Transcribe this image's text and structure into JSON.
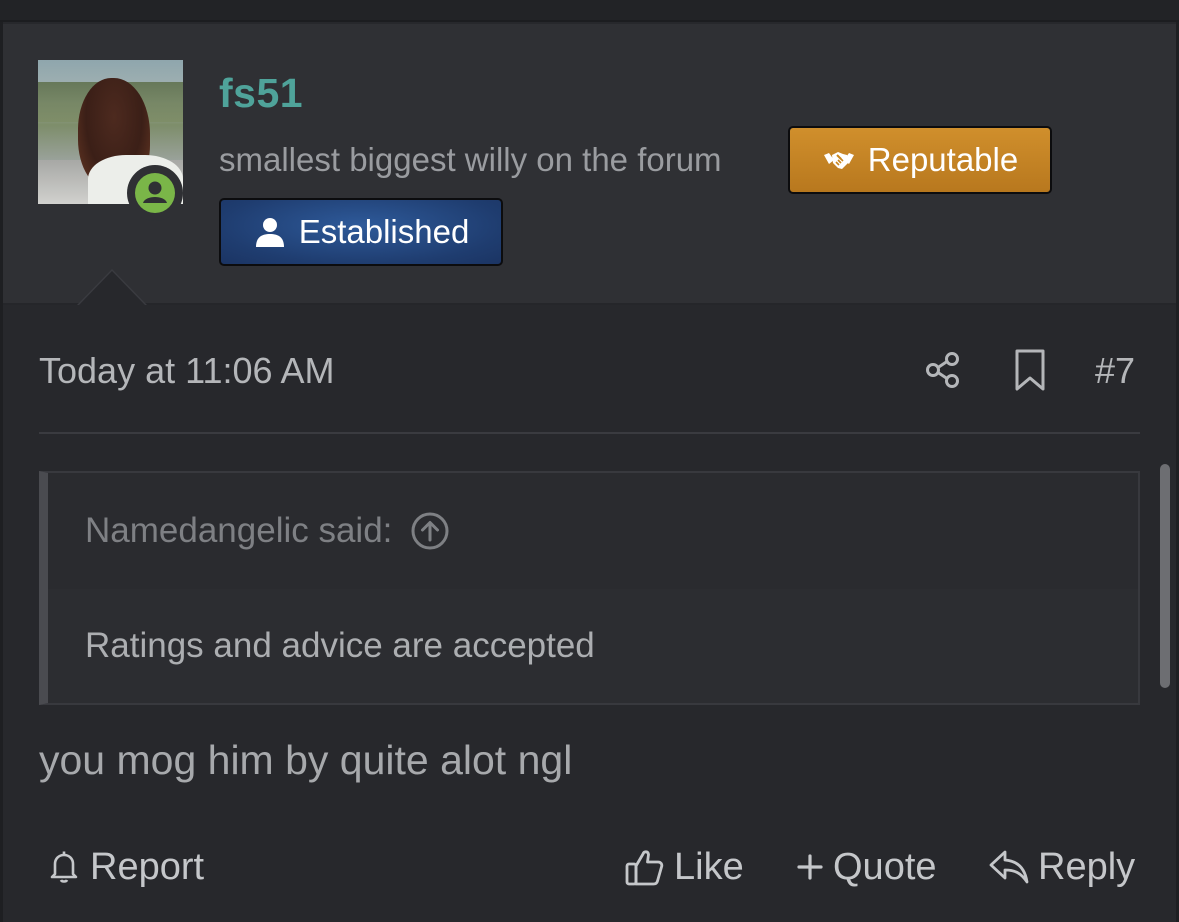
{
  "user": {
    "username": "fs51",
    "title": "smallest biggest willy on the forum",
    "status": "online",
    "banners": [
      {
        "label": "Reputable",
        "icon": "handshake-icon",
        "color": "#c8861f"
      },
      {
        "label": "Established",
        "icon": "user-icon",
        "color": "#23467f"
      }
    ]
  },
  "post": {
    "date": "Today at 11:06 AM",
    "number": "#7",
    "quote": {
      "author": "Namedangelic said:",
      "text": "Ratings and advice are accepted"
    },
    "body": "you mog him by quite alot ngl"
  },
  "actions": {
    "report": "Report",
    "like": "Like",
    "quote": "Quote",
    "reply": "Reply"
  },
  "colors": {
    "username": "#4fa39a",
    "online": "#7ab648",
    "background": "#27282c"
  }
}
